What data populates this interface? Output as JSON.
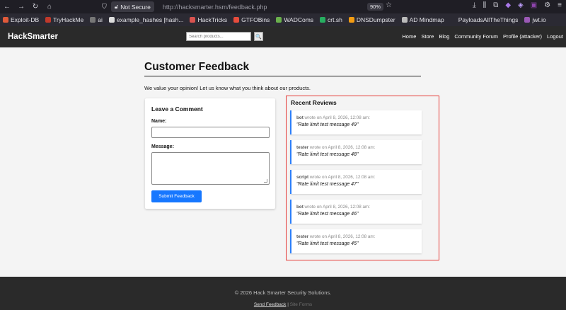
{
  "browser": {
    "security_label": "Not Secure",
    "url": "http://hacksmarter.hsm/feedback.php",
    "zoom": "90%",
    "bookmarks": [
      {
        "label": "Exploit-DB",
        "color": "#e05a3a"
      },
      {
        "label": "TryHackMe",
        "color": "#c0392b"
      },
      {
        "label": "ai",
        "color": "#777777"
      },
      {
        "label": "example_hashes [hash...",
        "color": "#dddddd"
      },
      {
        "label": "HackTricks",
        "color": "#d9534f"
      },
      {
        "label": "GTFOBins",
        "color": "#e74c3c"
      },
      {
        "label": "WADComs",
        "color": "#6ab04c"
      },
      {
        "label": "crt.sh",
        "color": "#27ae60"
      },
      {
        "label": "DNSDumpster",
        "color": "#f39c12"
      },
      {
        "label": "AD Mindmap",
        "color": "#bbbbbb"
      },
      {
        "label": "PayloadsAllTheThings",
        "color": "#2b2a33"
      },
      {
        "label": "jwt.io",
        "color": "#9b59b6"
      }
    ]
  },
  "site": {
    "brand": "HackSmarter",
    "search_placeholder": "Search products...",
    "search_button": "🔍",
    "nav": [
      "Home",
      "Store",
      "Blog",
      "Community Forum",
      "Profile (attacker)",
      "Logout"
    ]
  },
  "page": {
    "title": "Customer Feedback",
    "intro": "We value your opinion! Let us know what you think about our products."
  },
  "comment_form": {
    "title": "Leave a Comment",
    "name_label": "Name:",
    "name_value": "",
    "message_label": "Message:",
    "message_value": "",
    "submit_label": "Submit Feedback"
  },
  "reviews": {
    "title": "Recent Reviews",
    "items": [
      {
        "author": "bot",
        "meta": " wrote on April 8, 2026, 12:08 am:",
        "text": "\"Rate limit test message 49\""
      },
      {
        "author": "tester",
        "meta": " wrote on April 8, 2026, 12:08 am:",
        "text": "\"Rate limit test message 48\""
      },
      {
        "author": "script",
        "meta": " wrote on April 8, 2026, 12:08 am:",
        "text": "\"Rate limit test message 47\""
      },
      {
        "author": "bot",
        "meta": " wrote on April 8, 2026, 12:08 am:",
        "text": "\"Rate limit test message 46\""
      },
      {
        "author": "tester",
        "meta": " wrote on April 8, 2026, 12:08 am:",
        "text": "\"Rate limit test message 45\""
      }
    ]
  },
  "footer": {
    "copyright": "© 2026 Hack Smarter Security Solutions.",
    "link_feedback": "Send Feedback",
    "separator": " | ",
    "link_other": "Site Forms"
  },
  "colors": {
    "highlight_border": "#e53935",
    "accent": "#1677ff"
  }
}
